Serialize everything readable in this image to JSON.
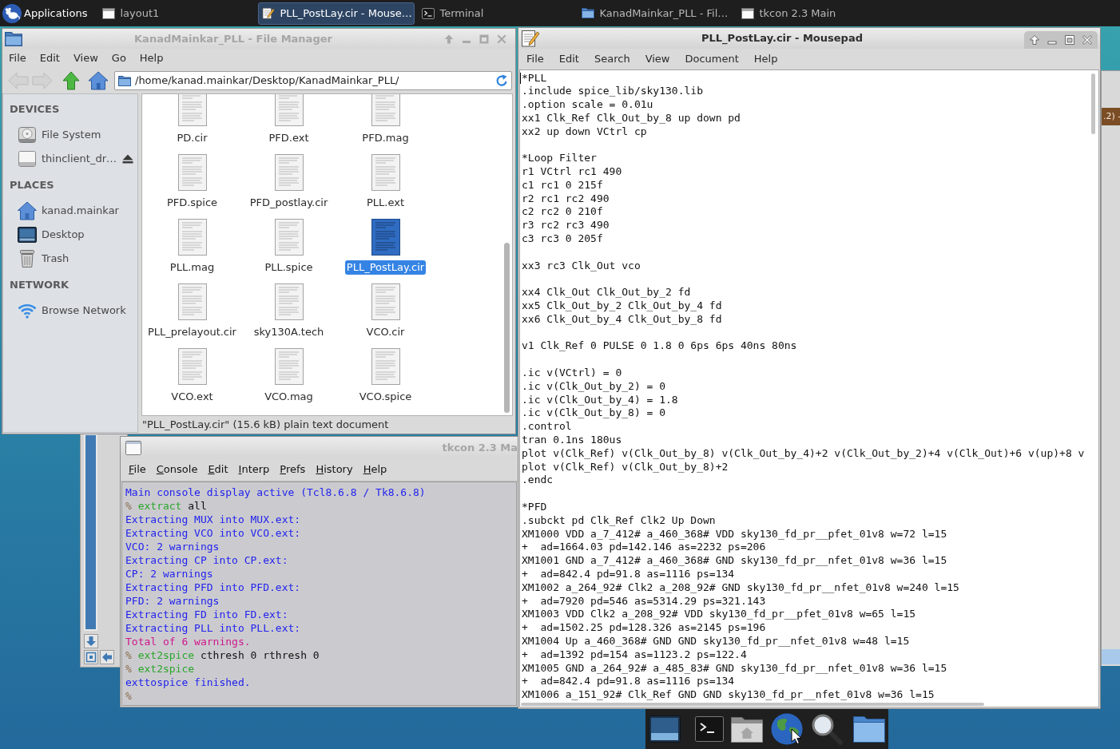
{
  "panel": {
    "applications": "Applications",
    "tasks": [
      {
        "label": "layout1",
        "kind": "window",
        "selected": false
      },
      {
        "label": "PLL_PostLay.cir - Mouse…",
        "kind": "editor",
        "selected": true
      },
      {
        "label": "Terminal",
        "kind": "terminal",
        "selected": false
      },
      {
        "label": "KanadMainkar_PLL - Fil…",
        "kind": "folder",
        "selected": false
      },
      {
        "label": "tkcon 2.3 Main",
        "kind": "window",
        "selected": false
      }
    ]
  },
  "file_manager": {
    "title": "KanadMainkar_PLL - File Manager",
    "focused": false,
    "menu": [
      "File",
      "Edit",
      "View",
      "Go",
      "Help"
    ],
    "path": "/home/kanad.mainkar/Desktop/KanadMainkar_PLL/",
    "sidebar": [
      {
        "heading": "DEVICES",
        "items": [
          {
            "label": "File System",
            "kind": "harddisk",
            "selected": false
          },
          {
            "label": "thinclient_dr…",
            "kind": "removable",
            "selected": false
          }
        ]
      },
      {
        "heading": "PLACES",
        "items": [
          {
            "label": "kanad.mainkar",
            "kind": "home",
            "selected": false
          },
          {
            "label": "Desktop",
            "kind": "desktop",
            "selected": false
          },
          {
            "label": "Trash",
            "kind": "trash",
            "selected": false
          }
        ]
      },
      {
        "heading": "NETWORK",
        "items": [
          {
            "label": "Browse Network",
            "kind": "network",
            "selected": false
          }
        ]
      }
    ],
    "files": [
      {
        "name": "PD.cir",
        "selected": false
      },
      {
        "name": "PFD.ext",
        "selected": false
      },
      {
        "name": "PFD.mag",
        "selected": false
      },
      {
        "name": "PFD.spice",
        "selected": false
      },
      {
        "name": "PFD_postlay.cir",
        "selected": false
      },
      {
        "name": "PLL.ext",
        "selected": false
      },
      {
        "name": "PLL.mag",
        "selected": false
      },
      {
        "name": "PLL.spice",
        "selected": false
      },
      {
        "name": "PLL_PostLay.cir",
        "selected": true
      },
      {
        "name": "PLL_prelayout.cir",
        "selected": false
      },
      {
        "name": "sky130A.tech",
        "selected": false
      },
      {
        "name": "VCO.cir",
        "selected": false
      },
      {
        "name": "VCO.ext",
        "selected": false
      },
      {
        "name": "VCO.mag",
        "selected": false
      },
      {
        "name": "VCO.spice",
        "selected": false
      }
    ],
    "status": "\"PLL_PostLay.cir\" (15.6 kB) plain text document"
  },
  "tkcon": {
    "title": "tkcon 2.3 Ma",
    "focused": false,
    "menu": [
      "File",
      "Console",
      "Edit",
      "Interp",
      "Prefs",
      "History",
      "Help"
    ],
    "lines": [
      {
        "kind": "output",
        "text": "Main console display active (Tcl8.6.8 / Tk8.6.8)"
      },
      {
        "kind": "prompt",
        "prompt": "%",
        "command": "extract",
        "args": "all"
      },
      {
        "kind": "output",
        "text": "Extracting MUX into MUX.ext:"
      },
      {
        "kind": "output",
        "text": "Extracting VCO into VCO.ext:"
      },
      {
        "kind": "output",
        "text": "VCO: 2 warnings"
      },
      {
        "kind": "output",
        "text": "Extracting CP into CP.ext:"
      },
      {
        "kind": "output",
        "text": "CP: 2 warnings"
      },
      {
        "kind": "output",
        "text": "Extracting PFD into PFD.ext:"
      },
      {
        "kind": "output",
        "text": "PFD: 2 warnings"
      },
      {
        "kind": "output",
        "text": "Extracting FD into FD.ext:"
      },
      {
        "kind": "output",
        "text": "Extracting PLL into PLL.ext:"
      },
      {
        "kind": "error",
        "text": "Total of 6 warnings."
      },
      {
        "kind": "prompt",
        "prompt": "%",
        "command": "ext2spice",
        "args": "cthresh 0 rthresh 0"
      },
      {
        "kind": "prompt",
        "prompt": "%",
        "command": "ext2spice"
      },
      {
        "kind": "output",
        "text": "exttospice finished."
      },
      {
        "kind": "prompt",
        "prompt": "%"
      }
    ]
  },
  "mousepad": {
    "title": "PLL_PostLay.cir - Mousepad",
    "focused": true,
    "menu": [
      "File",
      "Edit",
      "Search",
      "View",
      "Document",
      "Help"
    ],
    "blocks": [
      [
        "*PLL",
        ".include spice_lib/sky130.lib",
        ".option scale = 0.01u",
        "xx1 Clk_Ref Clk_Out_by_8 up down pd",
        "xx2 up down VCtrl cp"
      ],
      [
        "*Loop Filter",
        "r1 VCtrl rc1 490",
        "c1 rc1 0 215f",
        "r2 rc1 rc2 490",
        "c2 rc2 0 210f",
        "r3 rc2 rc3 490",
        "c3 rc3 0 205f"
      ],
      [
        "xx3 rc3 Clk_Out vco"
      ],
      [
        "xx4 Clk_Out Clk_Out_by_2 fd",
        "xx5 Clk_Out_by_2 Clk_Out_by_4 fd",
        "xx6 Clk_Out_by_4 Clk_Out_by_8 fd"
      ],
      [
        "v1 Clk_Ref 0 PULSE 0 1.8 0 6ps 6ps 40ns 80ns"
      ],
      [
        ".ic v(VCtrl) = 0",
        ".ic v(Clk_Out_by_2) = 0",
        ".ic v(Clk_Out_by_4) = 1.8",
        ".ic v(Clk_Out_by_8) = 0",
        ".control",
        "tran 0.1ns 180us",
        "plot v(Clk_Ref) v(Clk_Out_by_8) v(Clk_Out_by_4)+2 v(Clk_Out_by_2)+4 v(Clk_Out)+6 v(up)+8 v",
        "plot v(Clk_Ref) v(Clk_Out_by_8)+2",
        ".endc"
      ],
      [
        "*PFD",
        ".subckt pd Clk_Ref Clk2 Up Down",
        "XM1000 VDD a_7_412# a_460_368# VDD sky130_fd_pr__pfet_01v8 w=72 l=15",
        "+  ad=1664.03 pd=142.146 as=2232 ps=206",
        "XM1001 GND a_7_412# a_460_368# GND sky130_fd_pr__nfet_01v8 w=36 l=15",
        "+  ad=842.4 pd=91.8 as=1116 ps=134",
        "XM1002 a_264_92# Clk2 a_208_92# GND sky130_fd_pr__nfet_01v8 w=240 l=15",
        "+  ad=7920 pd=546 as=5314.29 ps=321.143",
        "XM1003 VDD Clk2 a_208_92# VDD sky130_fd_pr__pfet_01v8 w=65 l=15",
        "+  ad=1502.25 pd=128.326 as=2145 ps=196",
        "XM1004 Up a_460_368# GND GND sky130_fd_pr__nfet_01v8 w=48 l=15",
        "+  ad=1392 pd=154 as=1123.2 ps=122.4",
        "XM1005 GND a_264_92# a_485_83# GND sky130_fd_pr__nfet_01v8 w=36 l=15",
        "+  ad=842.4 pd=91.8 as=1116 ps=134",
        "XM1006 a_151_92# Clk_Ref GND GND sky130_fd_pr__nfet_01v8 w=36 l=15"
      ]
    ]
  },
  "background_window": {
    "title": ".2) -"
  }
}
